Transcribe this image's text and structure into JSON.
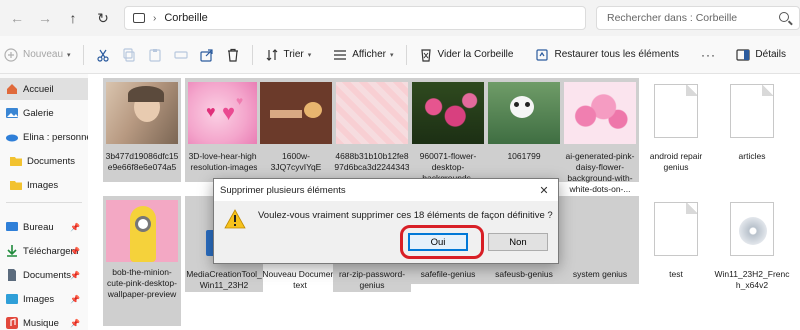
{
  "address": {
    "path": "Corbeille",
    "search_placeholder": "Rechercher dans : Corbeille"
  },
  "toolbar": {
    "new_label": "Nouveau",
    "sort_label": "Trier",
    "view_label": "Afficher",
    "empty_bin_label": "Vider la Corbeille",
    "restore_all_label": "Restaurer tous les éléments",
    "details_label": "Détails"
  },
  "sidebar": {
    "items": [
      {
        "label": "Accueil",
        "icon": "home-icon"
      },
      {
        "label": "Galerie",
        "icon": "gallery-icon"
      },
      {
        "label": "Elina : personne",
        "icon": "onedrive-icon"
      },
      {
        "label": "Documents",
        "icon": "folder-icon"
      },
      {
        "label": "Images",
        "icon": "folder-icon"
      },
      {
        "label": "Bureau",
        "icon": "desktop-icon"
      },
      {
        "label": "Téléchargem",
        "icon": "download-icon"
      },
      {
        "label": "Documents",
        "icon": "documents-icon"
      },
      {
        "label": "Images",
        "icon": "pictures-icon"
      },
      {
        "label": "Musique",
        "icon": "music-icon"
      }
    ]
  },
  "files": [
    {
      "name": "3b477d19086dfc15e9e66f8e6e074a5"
    },
    {
      "name": "3D-love-hear-high-resolution-images"
    },
    {
      "name": "1600w-3JQ7cyvIYqE"
    },
    {
      "name": "4688b31b10b12fe897d6bca3d2244343"
    },
    {
      "name": "960071-flower-desktop-backgrounds-1920x1200-for"
    },
    {
      "name": "1061799"
    },
    {
      "name": "ai-generated-pink-daisy-flower-background-with-white-dots-on-..."
    },
    {
      "name": "android repair genius"
    },
    {
      "name": "articles"
    },
    {
      "name": "bob-the-minion-cute-pink-desktop-wallpaper-preview"
    },
    {
      "name": "MediaCreationTool_Win11_23H2"
    },
    {
      "name": "Nouveau Document text"
    },
    {
      "name": "rar-zip-password-genius"
    },
    {
      "name": "safefile-genius"
    },
    {
      "name": "safeusb-genius"
    },
    {
      "name": "system genius"
    },
    {
      "name": "test"
    },
    {
      "name": "Win11_23H2_French_x64v2"
    }
  ],
  "dialog": {
    "title": "Supprimer plusieurs éléments",
    "message": "Voulez-vous vraiment supprimer ces 18 éléments de façon définitive ?",
    "yes_label": "Oui",
    "no_label": "Non"
  },
  "colors": {
    "highlight": "#d81f26",
    "accent": "#0078d7",
    "selection": "#cfcfcf"
  }
}
